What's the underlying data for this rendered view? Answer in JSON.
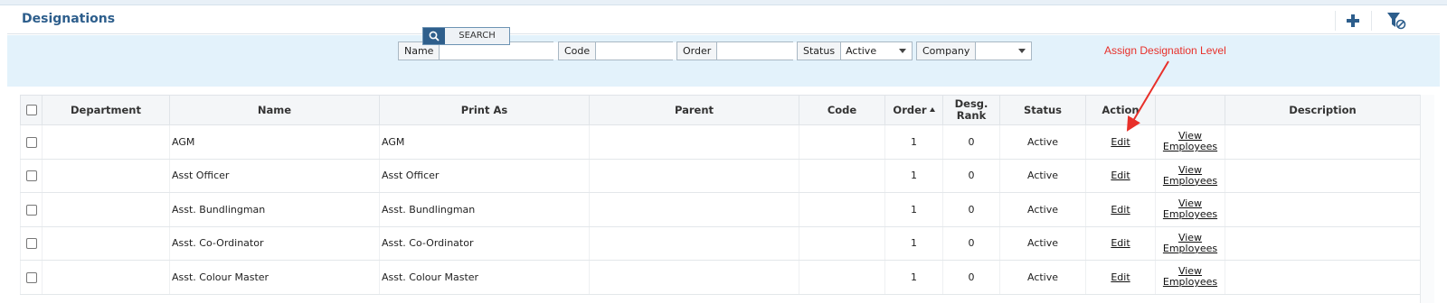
{
  "header": {
    "title": "Designations",
    "add_icon": "plus-icon",
    "filter_icon": "filter-clear-icon"
  },
  "filters": {
    "name_label": "Name",
    "name_value": "",
    "code_label": "Code",
    "code_value": "",
    "order_label": "Order",
    "order_value": "",
    "status_label": "Status",
    "status_value": "Active",
    "company_label": "Company",
    "company_value": "",
    "search_label": "SEARCH"
  },
  "annotation": {
    "text": "Assign Designation Level",
    "color": "#e8302a"
  },
  "table": {
    "headers": {
      "department": "Department",
      "name": "Name",
      "print_as": "Print As",
      "parent": "Parent",
      "code": "Code",
      "order": "Order",
      "desg_rank_1": "Desg.",
      "desg_rank_2": "Rank",
      "status": "Status",
      "action": "Action",
      "view": "",
      "description": "Description"
    },
    "rows": [
      {
        "department": "",
        "name": "AGM",
        "print_as": "AGM",
        "parent": "",
        "code": "",
        "order": "1",
        "rank": "0",
        "status": "Active",
        "edit": "Edit",
        "view_1": "View",
        "view_2": "Employees",
        "description": ""
      },
      {
        "department": "",
        "name": "Asst Officer",
        "print_as": "Asst Officer",
        "parent": "",
        "code": "",
        "order": "1",
        "rank": "0",
        "status": "Active",
        "edit": "Edit",
        "view_1": "View",
        "view_2": "Employees",
        "description": ""
      },
      {
        "department": "",
        "name": "Asst. Bundlingman",
        "print_as": "Asst. Bundlingman",
        "parent": "",
        "code": "",
        "order": "1",
        "rank": "0",
        "status": "Active",
        "edit": "Edit",
        "view_1": "View",
        "view_2": "Employees",
        "description": ""
      },
      {
        "department": "",
        "name": "Asst. Co-Ordinator",
        "print_as": "Asst. Co-Ordinator",
        "parent": "",
        "code": "",
        "order": "1",
        "rank": "0",
        "status": "Active",
        "edit": "Edit",
        "view_1": "View",
        "view_2": "Employees",
        "description": ""
      },
      {
        "department": "",
        "name": "Asst. Colour Master",
        "print_as": "Asst. Colour Master",
        "parent": "",
        "code": "",
        "order": "1",
        "rank": "0",
        "status": "Active",
        "edit": "Edit",
        "view_1": "View",
        "view_2": "Employees",
        "description": ""
      }
    ]
  }
}
